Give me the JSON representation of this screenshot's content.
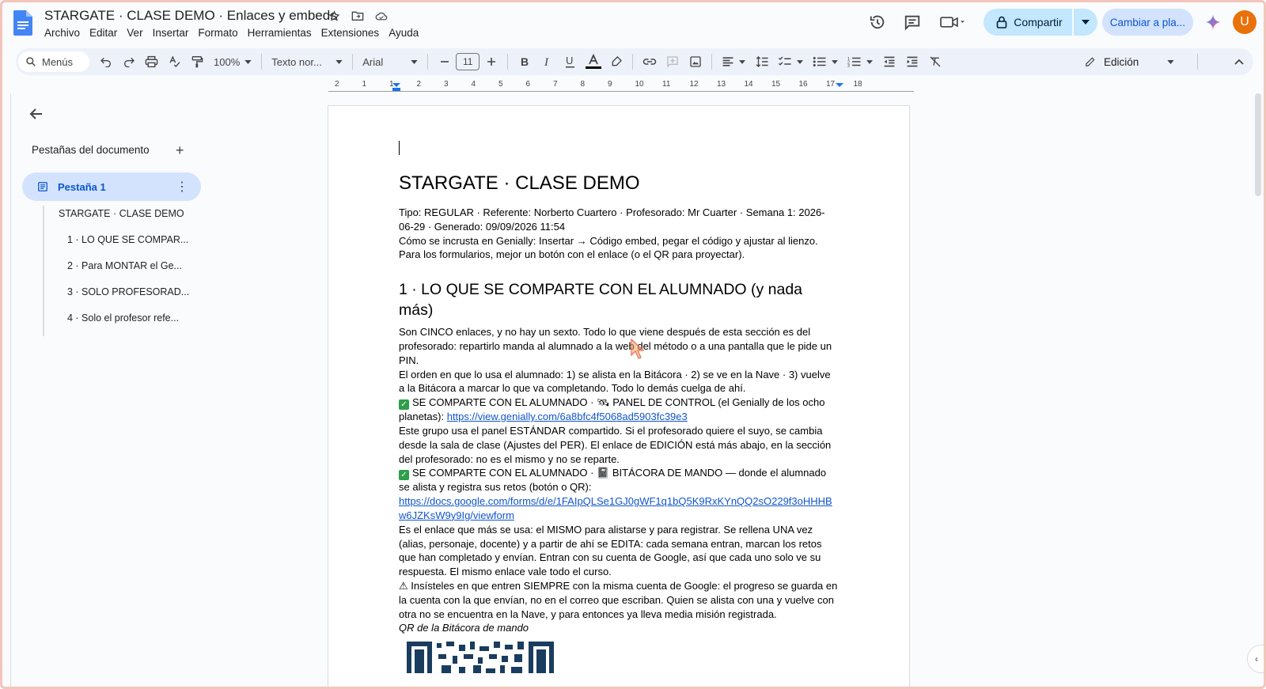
{
  "app": {
    "doc_title": "STARGATE · CLASE DEMO · Enlaces y embeds",
    "menu": [
      "Archivo",
      "Editar",
      "Ver",
      "Insertar",
      "Formato",
      "Herramientas",
      "Extensiones",
      "Ayuda"
    ],
    "share_label": "Compartir",
    "switch_label": "Cambiar a pla...",
    "avatar_letter": "U"
  },
  "toolbar": {
    "search_placeholder": "Menús",
    "zoom": "100%",
    "style": "Texto nor...",
    "font": "Arial",
    "font_size": "11",
    "mode": "Edición"
  },
  "ruler": {
    "numbers": [
      "2",
      "1",
      "1",
      "2",
      "3",
      "4",
      "5",
      "6",
      "7",
      "8",
      "9",
      "10",
      "11",
      "12",
      "13",
      "14",
      "15",
      "16",
      "17",
      "18"
    ]
  },
  "sidebar": {
    "title": "Pestañas del documento",
    "active_tab": "Pestaña 1",
    "outline": [
      "STARGATE · CLASE DEMO",
      "1 · LO QUE SE COMPAR...",
      "2 · Para MONTAR el Ge...",
      "3 · SOLO PROFESORAD...",
      "4 · Solo el profesor refe..."
    ]
  },
  "document": {
    "title": "STARGATE · CLASE DEMO",
    "meta_line": "Tipo: REGULAR · Referente: Norberto Cuartero · Profesorado: Mr Cuarter · Semana 1: 2026-06-29 · Generado: 09/09/2026 11:54",
    "embed_line": "Cómo se incrusta en Genially: Insertar → Código embed, pegar el código y ajustar al lienzo. Para los formularios, mejor un botón con el enlace (o el QR para proyectar).",
    "section1_heading": "1 · LO QUE SE COMPARTE CON EL ALUMNADO (y nada más)",
    "section1_intro": "Son CINCO enlaces, y no hay un sexto. Todo lo que viene después de esta sección es del profesorado: repartirlo manda al alumnado a la web del método o a una pantalla que le pide un PIN.",
    "section1_order": "El orden en que lo usa el alumnado: 1) se alista en la Bitácora · 2) se ve en la Nave · 3) vuelve a la Bitácora a marcar lo que va completando. Todo lo demás cuelga de ahí.",
    "panel_label": "SE COMPARTE CON EL ALUMNADO · 🛰 PANEL DE CONTROL (el Genially de los ocho planetas):",
    "panel_link": "https://view.genially.com/6a8bfc4f5068ad5903fc39e3",
    "panel_note": "Este grupo usa el panel ESTÁNDAR compartido. Si el profesorado quiere el suyo, se cambia desde la sala de clase (Ajustes del PER). El enlace de EDICIÓN está más abajo, en la sección del profesorado: no es el mismo y no se reparte.",
    "bitacora_label": "SE COMPARTE CON EL ALUMNADO · 📓 BITÁCORA DE MANDO — donde el alumnado se alista y registra sus retos (botón o QR):",
    "bitacora_link": "https://docs.google.com/forms/d/e/1FAIpQLSe1GJ0gWF1q1bQ5K9RxKYnQQ2sO229f3oHHHBw6JZKsW9y9Ig/viewform",
    "bitacora_note": "Es el enlace que más se usa: el MISMO para alistarse y para registrar. Se rellena UNA vez (alias, personaje, docente) y a partir de ahí se EDITA: cada semana entran, marcan los retos que han completado y envían. Entran con su cuenta de Google, así que cada uno solo ve su respuesta. El mismo enlace vale todo el curso.",
    "warning": "⚠ Insísteles en que entren SIEMPRE con la misma cuenta de Google: el progreso se guarda en la cuenta con la que envían, no en el correo que escriban. Quien se alista con una y vuelve con otra no se encuentra en la Nave, y para entonces ya lleva media misión registrada.",
    "qr_caption": "QR de la Bitácora de mando"
  }
}
